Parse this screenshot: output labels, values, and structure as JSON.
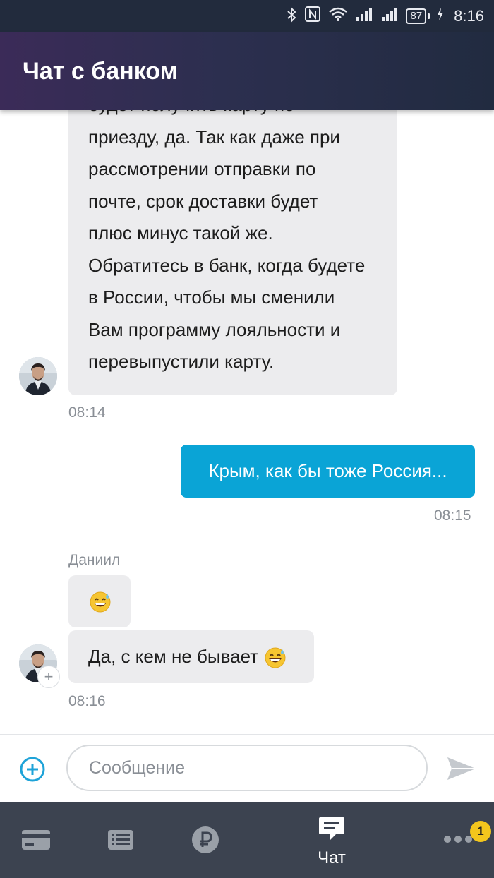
{
  "status_bar": {
    "icons": [
      "bluetooth-icon",
      "nfc-icon",
      "wifi-icon",
      "signal-r-icon",
      "signal-icon",
      "battery-icon"
    ],
    "battery": "87",
    "time": "8:16"
  },
  "header": {
    "title": "Чат с банком"
  },
  "messages": {
    "m1": {
      "lines": [
        "будет получить карту по",
        "приезду, да. Так как даже при",
        "рассмотрении отправки по",
        "почте, срок доставки будет",
        "плюс минус такой же.",
        "Обратитесь в банк, когда будете",
        "в России, чтобы мы сменили",
        "Вам программу лояльности и",
        "перевыпустили карту."
      ],
      "time": "08:14"
    },
    "m2": {
      "text": "Крым, как бы тоже Россия...",
      "time": "08:15"
    },
    "m3": {
      "sender": "Даниил",
      "text": "Да, с кем не бывает",
      "emoji": "grinning-sweat-emoji",
      "time": "08:16"
    }
  },
  "composer": {
    "placeholder": "Сообщение"
  },
  "bottom_nav": {
    "items": [
      {
        "icon": "card-icon",
        "label": ""
      },
      {
        "icon": "list-icon",
        "label": ""
      },
      {
        "icon": "ruble-icon",
        "label": ""
      },
      {
        "icon": "chat-icon",
        "label": "Чат"
      },
      {
        "icon": "more-icon",
        "label": ""
      }
    ],
    "more_badge": "1"
  },
  "colors": {
    "status_bar": "#222b3d",
    "outgoing_bubble": "#0aa4d6",
    "incoming_bubble": "#ececee",
    "nav": "#3c4350",
    "badge": "#f3c61d"
  }
}
